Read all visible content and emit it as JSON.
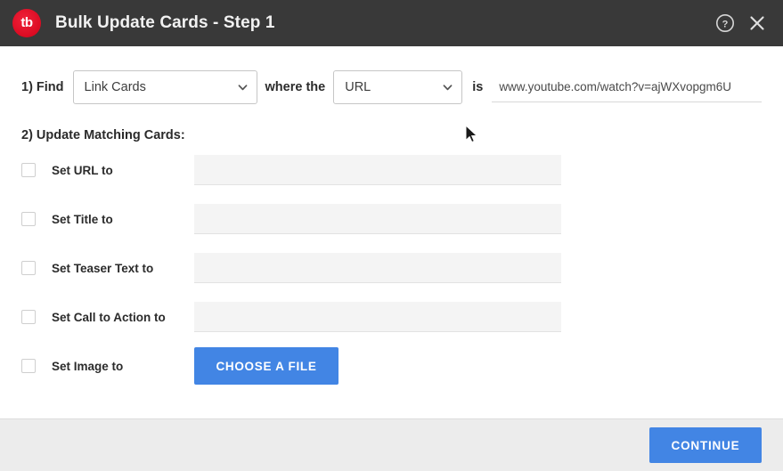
{
  "window": {
    "logo_text": "tb",
    "title": "Bulk Update Cards - Step 1",
    "help_icon": "help-circle-icon",
    "close_icon": "close-icon"
  },
  "find_section": {
    "step_label": "1) Find",
    "card_type_value": "Link Cards",
    "middle_label": "where the",
    "field_value": "URL",
    "is_label": "is",
    "url_value": "www.youtube.com/watch?v=ajWXvopgm6U",
    "url_placeholder": ""
  },
  "update_section": {
    "heading": "2) Update Matching Cards:",
    "rows": [
      {
        "label": "Set URL to",
        "value": "",
        "control": "text"
      },
      {
        "label": "Set Title to",
        "value": "",
        "control": "text"
      },
      {
        "label": "Set Teaser Text to",
        "value": "",
        "control": "text"
      },
      {
        "label": "Set Call to Action to",
        "value": "",
        "control": "text"
      },
      {
        "label": "Set Image to",
        "value": "",
        "control": "button",
        "button_label": "CHOOSE A FILE"
      }
    ]
  },
  "footer": {
    "continue_label": "CONTINUE"
  },
  "colors": {
    "header_bg": "#393939",
    "accent_blue": "#4285e4",
    "logo_red": "#e8122a",
    "footer_bg": "#ececec",
    "input_bg": "#f4f4f4"
  }
}
